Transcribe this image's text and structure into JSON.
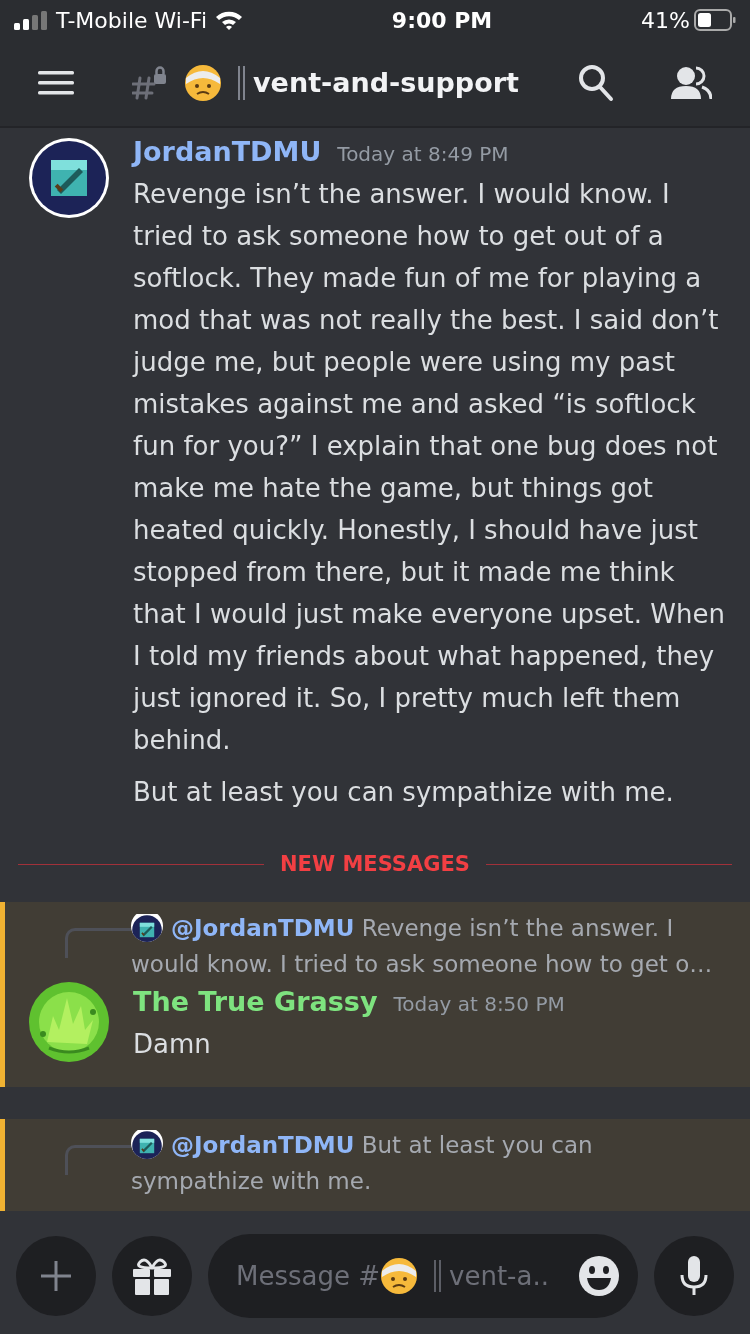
{
  "status_bar": {
    "carrier": "T-Mobile Wi-Fi",
    "time": "9:00 PM",
    "battery": "41%"
  },
  "header": {
    "channel": "vent-and-support"
  },
  "messages": [
    {
      "kind": "message",
      "author": "JordanTDMU",
      "color": "#8fb6f7",
      "timestamp": "Today at 8:49 PM",
      "highlighted": false,
      "paragraphs": [
        "Revenge isn’t the answer. I would know. I tried to ask someone how to get out of a softlock. They made fun of me for playing a mod that was not really the best. I said don’t judge me, but people were using my past mistakes against me and asked “is softlock fun for you?” I explain that one bug does not make me hate the game, but things got heated quickly. Honestly, I should have just stopped from there, but it made me think that I would just make everyone upset. When I told my friends about what happened, they just ignored it. So, I pretty much left them behind.",
        "But at least you can sympathize with me."
      ]
    },
    {
      "kind": "divider",
      "label": "NEW MESSAGES"
    },
    {
      "kind": "message",
      "reply": {
        "author": "@JordanTDMU",
        "text": "Revenge isn’t the answer. I would know. I tried to ask someone how to get o…"
      },
      "author": "The True Grassy",
      "color": "#7ee37f",
      "timestamp": "Today at 8:50 PM",
      "highlighted": true,
      "paragraphs": [
        "Damn"
      ]
    },
    {
      "kind": "message",
      "reply": {
        "author": "@JordanTDMU",
        "text": "But at least you can sympathize with me."
      },
      "highlighted": true
    }
  ],
  "composer": {
    "placeholder": "Message #",
    "channel_hint": "vent-a.."
  }
}
